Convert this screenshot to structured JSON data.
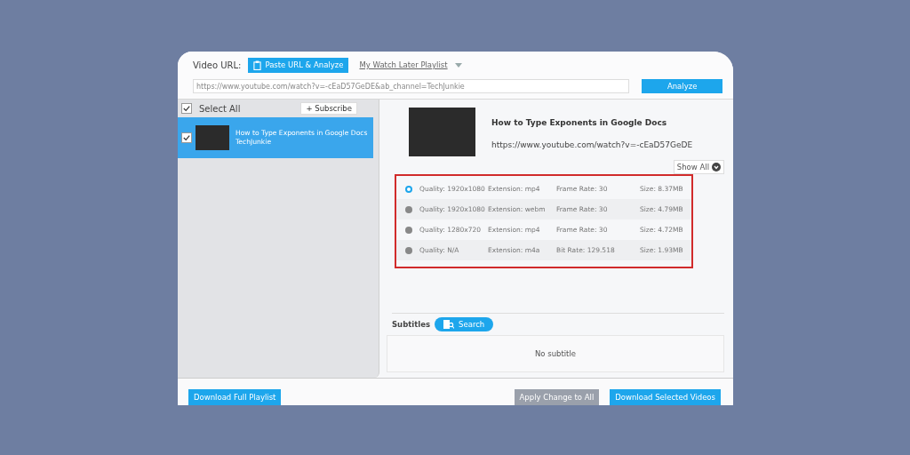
{
  "header": {
    "url_label": "Video URL:",
    "paste_button": "Paste URL & Analyze",
    "playlist_link": "My Watch Later Playlist",
    "url_value": "https://www.youtube.com/watch?v=-cEaD57GeDE&ab_channel=TechJunkie",
    "analyze_button": "Analyze"
  },
  "sidebar": {
    "select_all": {
      "label": "Select All",
      "checked": true
    },
    "subscribe_button": "+ Subscribe",
    "items": [
      {
        "title": "How to Type Exponents in Google Docs",
        "channel": "TechJunkie",
        "checked": true,
        "selected": true
      }
    ]
  },
  "video": {
    "title": "How to Type Exponents in Google Docs",
    "url": "https://www.youtube.com/watch?v=-cEaD57GeDE",
    "show_all_button": "Show All"
  },
  "formats": [
    {
      "quality": "Quality: 1920x1080",
      "extension": "Extension: mp4",
      "rate": "Frame Rate: 30",
      "size": "Size: 8.37MB",
      "selected": true
    },
    {
      "quality": "Quality: 1920x1080",
      "extension": "Extension: webm",
      "rate": "Frame Rate: 30",
      "size": "Size: 4.79MB",
      "selected": false
    },
    {
      "quality": "Quality: 1280x720",
      "extension": "Extension: mp4",
      "rate": "Frame Rate: 30",
      "size": "Size: 4.72MB",
      "selected": false
    },
    {
      "quality": "Quality: N/A",
      "extension": "Extension: m4a",
      "rate": "Bit Rate: 129.518",
      "size": "Size: 1.93MB",
      "selected": false
    }
  ],
  "subtitles": {
    "label": "Subtitles",
    "search_button": "Search",
    "empty_text": "No subtitle"
  },
  "footer": {
    "download_playlist_button": "Download Full Playlist",
    "apply_button": "Apply Change to All",
    "download_selected_button": "Download Selected Videos"
  }
}
